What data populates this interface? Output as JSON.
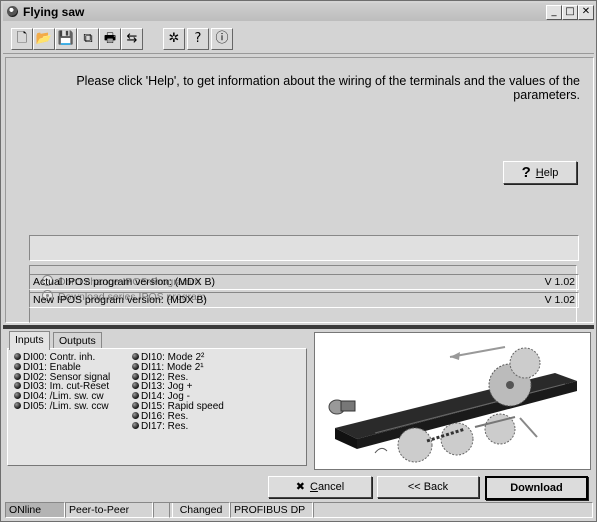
{
  "window": {
    "title": "Flying saw"
  },
  "toolbar": {
    "buttons": [
      {
        "name": "new-file-icon",
        "glyph": "🗋"
      },
      {
        "name": "open-folder-icon",
        "glyph": "📂"
      },
      {
        "name": "save-icon",
        "glyph": "💾"
      },
      {
        "name": "copy-icon",
        "glyph": "⧉"
      },
      {
        "name": "print-icon",
        "glyph": "🖶"
      },
      {
        "name": "transfer-icon",
        "glyph": "⇆"
      },
      {
        "name": "tools-icon",
        "glyph": "✲"
      },
      {
        "name": "help-icon",
        "glyph": "?"
      },
      {
        "name": "info-icon",
        "glyph": "ⓘ"
      }
    ]
  },
  "main": {
    "info_text": "Please click 'Help', to get information about the wiring of the terminals and the values of the parameters.",
    "help_button": {
      "icon": "?",
      "label_underlined": "H",
      "label_rest": "elp"
    },
    "options": [
      {
        "label": "Don't change IPOS-Programm",
        "selected": false
      },
      {
        "label": "Download series IPOS program",
        "selected": true
      }
    ],
    "actual_version": {
      "label": "Actual IPOS program version: (MDX B)",
      "value": "V  1.02"
    },
    "new_version": {
      "label": "New IPOS program version: (MDX B)",
      "value": "V  1.02"
    }
  },
  "tabs": [
    "Inputs",
    "Outputs"
  ],
  "inputs_left": [
    "DI00: Contr. inh.",
    "DI01: Enable",
    "DI02: Sensor signal",
    "DI03: Im. cut-Reset",
    "DI04: /Lim. sw. cw",
    "DI05: /Lim. sw. ccw"
  ],
  "inputs_right": [
    "DI10: Mode 2²",
    "DI11: Mode 2¹",
    "DI12: Res.",
    "DI13: Jog +",
    "DI14: Jog -",
    "DI15: Rapid speed",
    "DI16: Res.",
    "DI17: Res."
  ],
  "buttons": {
    "cancel": {
      "underlined": "C",
      "rest": "ancel",
      "icon": "✖"
    },
    "back": "<< Back",
    "download": "Download"
  },
  "statusbar": [
    "ONline",
    "Peer-to-Peer",
    "",
    "Changed",
    "PROFIBUS DP",
    ""
  ]
}
